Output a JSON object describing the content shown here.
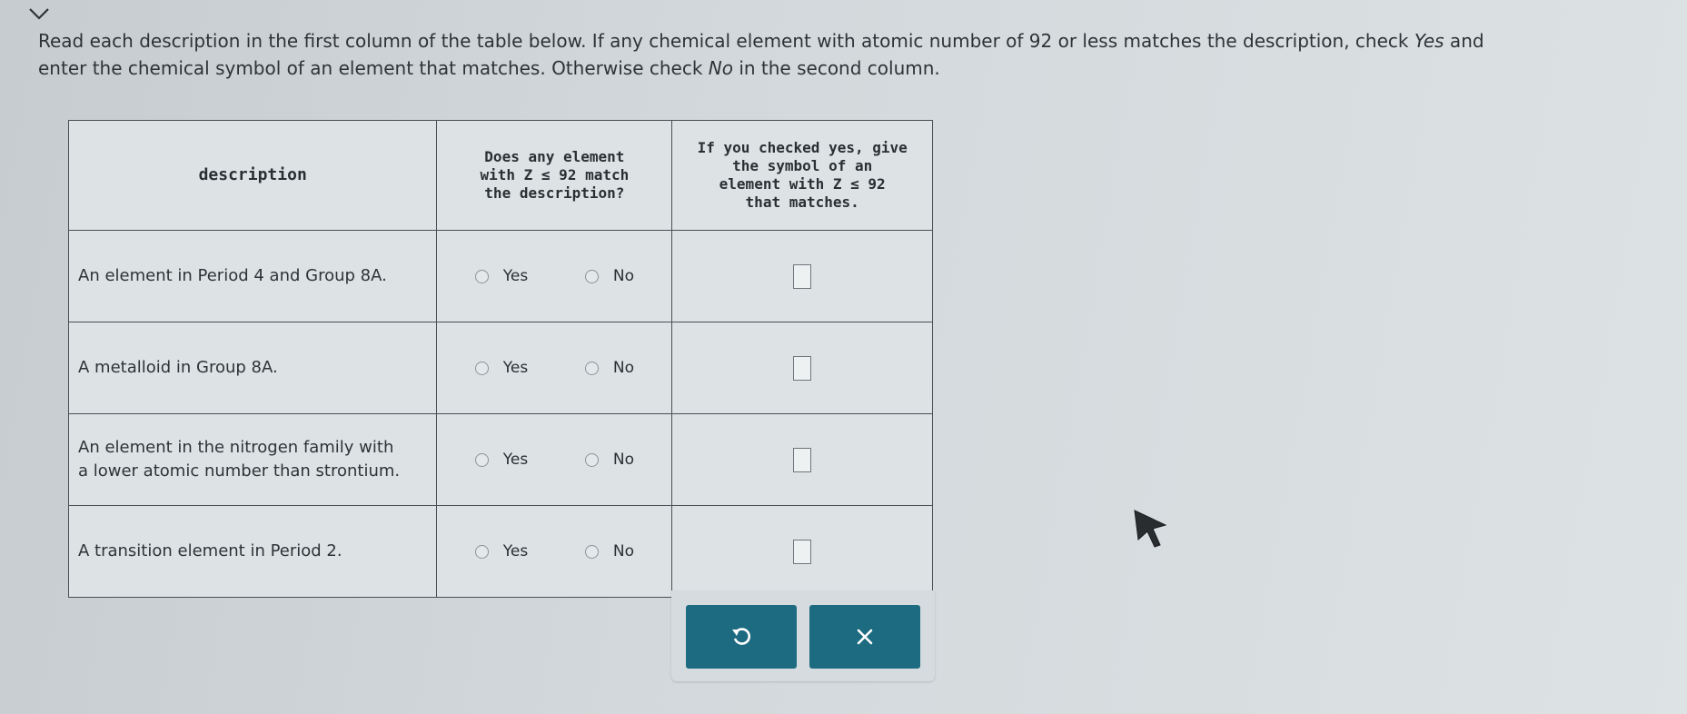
{
  "instructions": {
    "line1_pre": "Read each description in the first column of the table below. If any chemical element with atomic number of 92 or less matches the description, check ",
    "line1_yes": "Yes",
    "line1_post": " and",
    "line2_pre": "enter the chemical symbol of an element that matches. Otherwise check ",
    "line2_no": "No",
    "line2_post": " in the second column."
  },
  "table": {
    "headers": {
      "description": "description",
      "match_l1": "Does any element",
      "match_l2": "with Z ≤ 92 match",
      "match_l3": "the description?",
      "symbol_l1": "If you checked yes, give",
      "symbol_l2": "the symbol of an",
      "symbol_l3": "element with Z ≤ 92",
      "symbol_l4": "that matches."
    },
    "rows": [
      {
        "desc_l1": "An element in Period 4 and Group 8A.",
        "desc_l2": "",
        "yes": "Yes",
        "no": "No",
        "symbol": ""
      },
      {
        "desc_l1": "A metalloid in Group 8A.",
        "desc_l2": "",
        "yes": "Yes",
        "no": "No",
        "symbol": ""
      },
      {
        "desc_l1": "An element in the nitrogen family with",
        "desc_l2": "a lower atomic number than strontium.",
        "yes": "Yes",
        "no": "No",
        "symbol": ""
      },
      {
        "desc_l1": "A transition element in Period 2.",
        "desc_l2": "",
        "yes": "Yes",
        "no": "No",
        "symbol": ""
      }
    ]
  },
  "actions": {
    "undo_icon": "undo-icon",
    "clear_icon": "close-icon",
    "button_color": "#1d6b80"
  }
}
